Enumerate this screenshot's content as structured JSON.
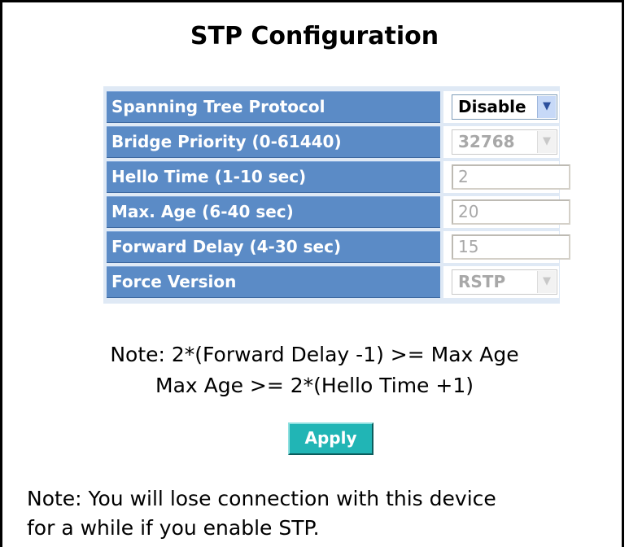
{
  "page": {
    "title": "STP Configuration"
  },
  "rows": [
    {
      "label": "Spanning Tree Protocol",
      "control": "select",
      "value": "Disable",
      "enabled": true
    },
    {
      "label": "Bridge Priority (0-61440)",
      "control": "select",
      "value": "32768",
      "enabled": false
    },
    {
      "label": "Hello Time (1-10 sec)",
      "control": "text",
      "value": "2",
      "enabled": false
    },
    {
      "label": "Max. Age (6-40 sec)",
      "control": "text",
      "value": "20",
      "enabled": false
    },
    {
      "label": "Forward Delay (4-30 sec)",
      "control": "text",
      "value": "15",
      "enabled": false
    },
    {
      "label": "Force Version",
      "control": "select",
      "value": "RSTP",
      "enabled": false
    }
  ],
  "notes": {
    "line1": "Note: 2*(Forward Delay -1) >= Max Age",
    "line2": "Max Age >= 2*(Hello Time +1)",
    "warning_line1": "Note: You will lose connection with this device",
    "warning_line2": "for a while if you enable STP."
  },
  "buttons": {
    "apply": "Apply"
  },
  "colors": {
    "label_bg": "#5b8bc6",
    "table_bg": "#dfe9f5",
    "apply_bg": "#21b5b5"
  },
  "icons": {
    "dropdown": "chevron-down-icon"
  }
}
